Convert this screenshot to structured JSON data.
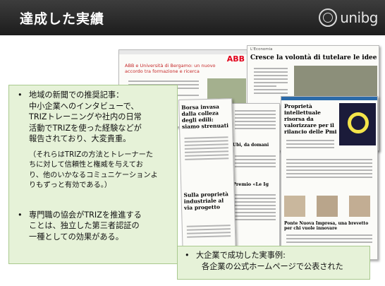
{
  "slide": {
    "title": "達成した実績"
  },
  "logo": {
    "text": "unibg"
  },
  "panel": {
    "bullet_marker": "•",
    "point1_lines": [
      "地域の新聞での推奨記事：",
      "中小企業へのインタビューで、",
      "TRIZトレーニングや社内の日常",
      "活動でTRIZを使った経験などが",
      "報告されており、大変貴重。"
    ],
    "note_lines": [
      "（それらはTRIZの方法とトレーナーた",
      "ちに対して信頼性と権威を与えてお",
      "り、他のいかなるコミュニケーションよ",
      "りもずっと有効である。）"
    ],
    "point2_lines": [
      "専門職の協会がTRIZを推進する",
      "ことは、独立した第三者認証の",
      "一種としての効果がある。"
    ]
  },
  "callout": {
    "bullet_marker": "•",
    "line1": "大企業で成功した実事例:",
    "line2": "各企業の公式ホームページで公表された"
  },
  "clippings": {
    "abb_brand": "ABB",
    "abb_headline": "ABB e Università di Bergamo: un nuovo accordo tra formazione e ricerca",
    "eco_section": "L'Economia",
    "eco_headline": "Cresce la volontà di tutelare le idee",
    "borsa_headline": "Borsa invasa dalla colleza degli edili: siamo strenuati",
    "proprieta_headline": "Proprietà intellettuale risorsa da valorizzare per il rilancio delle Pmi",
    "sulla_headline": "Sulla proprietà industriale al via progetto",
    "ubi_text": "Ubi, da domani",
    "premio_text": "Premio «Le Ig",
    "ponte_text": "Ponte Nuova Impresa, una brevetto per chi vuole innovare"
  }
}
